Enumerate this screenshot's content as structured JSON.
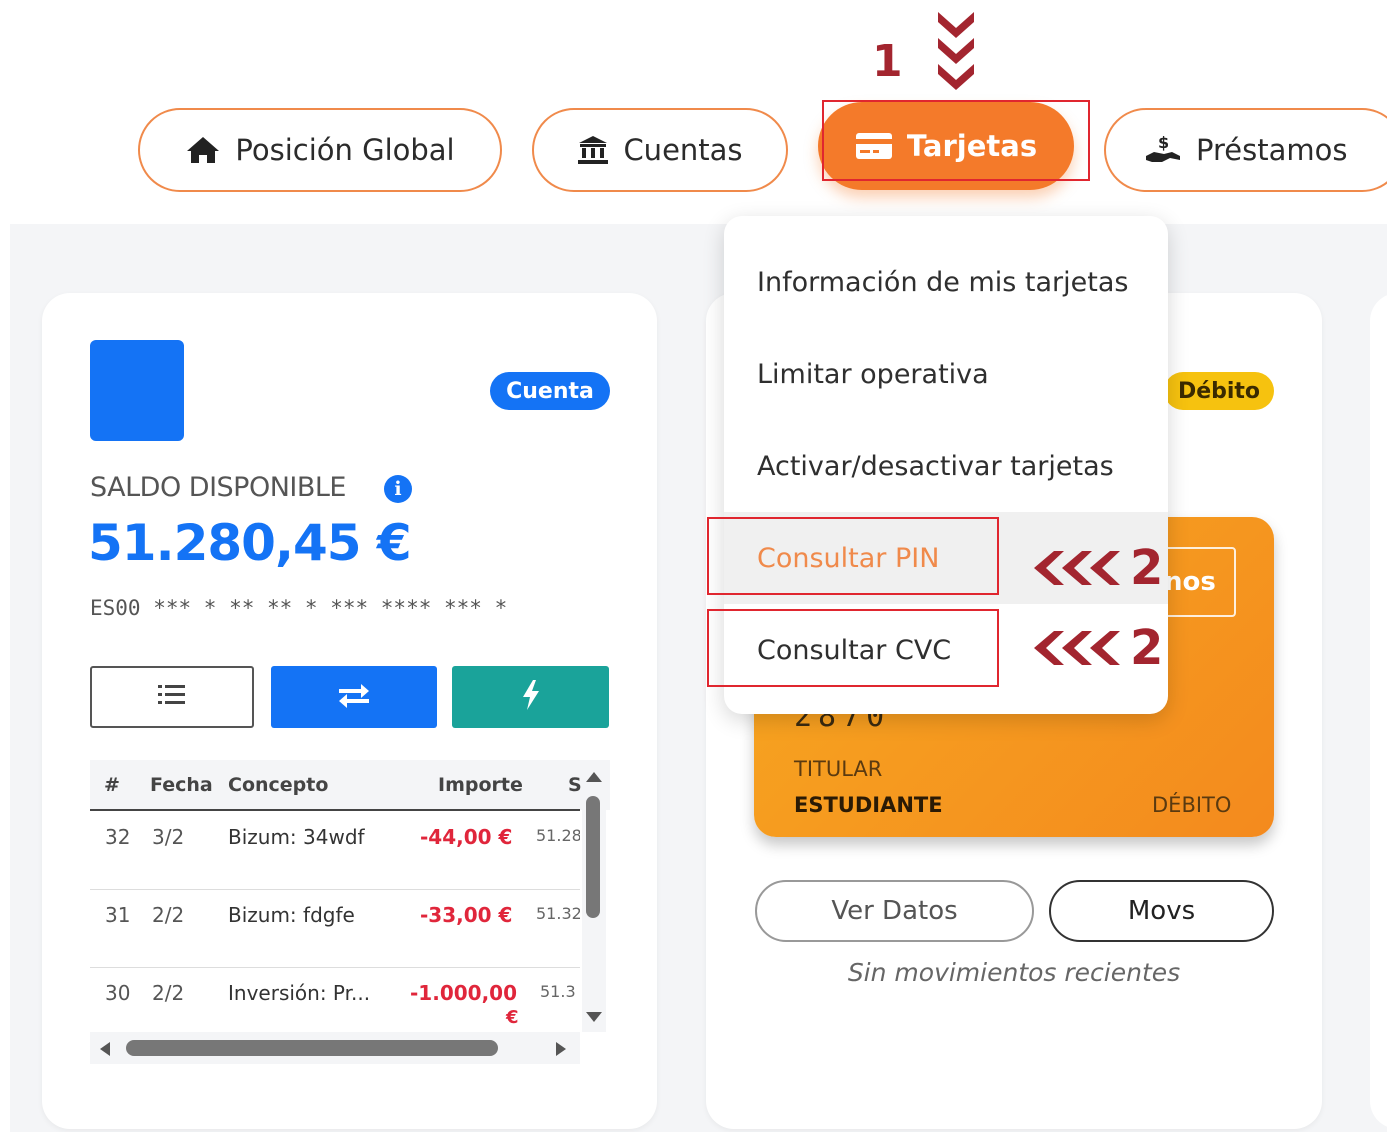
{
  "nav": {
    "items": [
      {
        "label": "Posición Global",
        "icon": "home-icon"
      },
      {
        "label": "Cuentas",
        "icon": "bank-icon"
      },
      {
        "label": "Tarjetas",
        "icon": "card-icon",
        "active": true
      },
      {
        "label": "Préstamos",
        "icon": "loan-icon"
      }
    ],
    "step_marker": "1"
  },
  "account_card": {
    "badge": "Cuenta",
    "balance_label": "SALDO DISPONIBLE",
    "balance": "51.280,45 €",
    "iban": "ES00 *** * ** ** * *** **** *** *",
    "colors": {
      "logo": "#1473f5",
      "transfer": "#1473f5",
      "bizum": "#1aa39a"
    },
    "table": {
      "headers": [
        "#",
        "Fecha",
        "Concepto",
        "Importe",
        "S"
      ],
      "rows": [
        {
          "n": "32",
          "date": "3/2",
          "concept": "Bizum: 34wdf",
          "amount": "-44,00 €",
          "balance": "51.28"
        },
        {
          "n": "31",
          "date": "2/2",
          "concept": "Bizum: fdgfe",
          "amount": "-33,00 €",
          "balance": "51.32"
        },
        {
          "n": "30",
          "date": "2/2",
          "concept": "Inversión: Pr...",
          "amount": "-1.000,00",
          "amount_suffix": "€",
          "balance": "51.3"
        }
      ]
    }
  },
  "card_panel": {
    "badge": "Débito",
    "brand_partial": "nos",
    "number_partial": "2870",
    "holder_label": "TITULAR",
    "holder_name": "ESTUDIANTE",
    "card_type": "DÉBITO",
    "buttons": {
      "details": "Ver Datos",
      "movements": "Movs"
    },
    "empty_movements": "Sin movimientos recientes"
  },
  "dropdown": {
    "items": [
      "Información de mis tarjetas",
      "Limitar operativa",
      "Activar/desactivar tarjetas",
      "Consultar PIN",
      "Consultar CVC"
    ],
    "step_marker": "2"
  },
  "colors": {
    "accent": "#f47a2a",
    "marker": "#a3252f",
    "highlight": "#e0262f"
  }
}
